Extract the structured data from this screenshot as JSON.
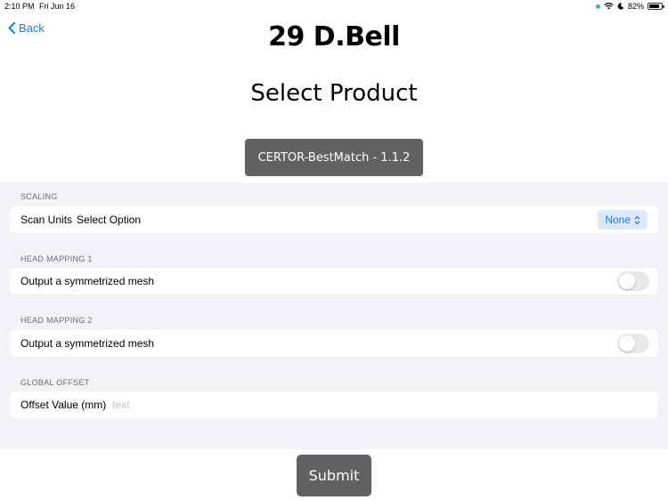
{
  "status_bar": {
    "time": "2:10 PM",
    "date": "Fri Jun 16",
    "battery": "82%",
    "battery_level": 0.82
  },
  "nav": {
    "back_label": "Back"
  },
  "app_title": "29 D.Bell",
  "page_title": "Select Product",
  "product_button_label": "CERTOR-BestMatch - 1.1.2",
  "sections": {
    "scaling": {
      "header": "SCALING",
      "label": "Scan Units",
      "sublabel": "Select Option",
      "value": "None"
    },
    "head_mapping_1": {
      "header": "HEAD MAPPING 1",
      "label": "Output a symmetrized mesh",
      "toggle_on": false
    },
    "head_mapping_2": {
      "header": "HEAD MAPPING 2",
      "label": "Output a symmetrized mesh",
      "toggle_on": false
    },
    "global_offset": {
      "header": "GLOBAL OFFSET",
      "label": "Offset Value (mm)",
      "placeholder": "text"
    }
  },
  "submit_label": "Submit",
  "colors": {
    "accent": "#1a7ae8",
    "button_bg": "#616161",
    "form_bg": "#f2f2f7",
    "status_dot": "#34c759"
  }
}
